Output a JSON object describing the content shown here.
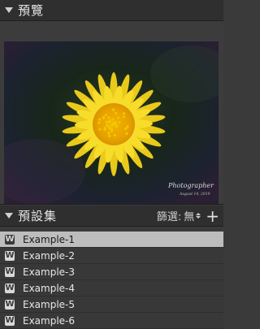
{
  "preview": {
    "title": "預覽",
    "watermark_name": "Photographer",
    "watermark_date": "August 14, 2019"
  },
  "presets": {
    "title": "預設集",
    "filter_label": "篩選:",
    "filter_value": "無",
    "add_label": "+",
    "items": [
      {
        "icon": "W",
        "label": "Example-1",
        "selected": true
      },
      {
        "icon": "W",
        "label": "Example-2",
        "selected": false
      },
      {
        "icon": "W",
        "label": "Example-3",
        "selected": false
      },
      {
        "icon": "W",
        "label": "Example-4",
        "selected": false
      },
      {
        "icon": "W",
        "label": "Example-5",
        "selected": false
      },
      {
        "icon": "W",
        "label": "Example-6",
        "selected": false
      }
    ]
  },
  "colors": {
    "selected_row": "#bdbdbd",
    "panel_bg": "#3a3a3a",
    "flower_petal": "#f4d21a"
  }
}
